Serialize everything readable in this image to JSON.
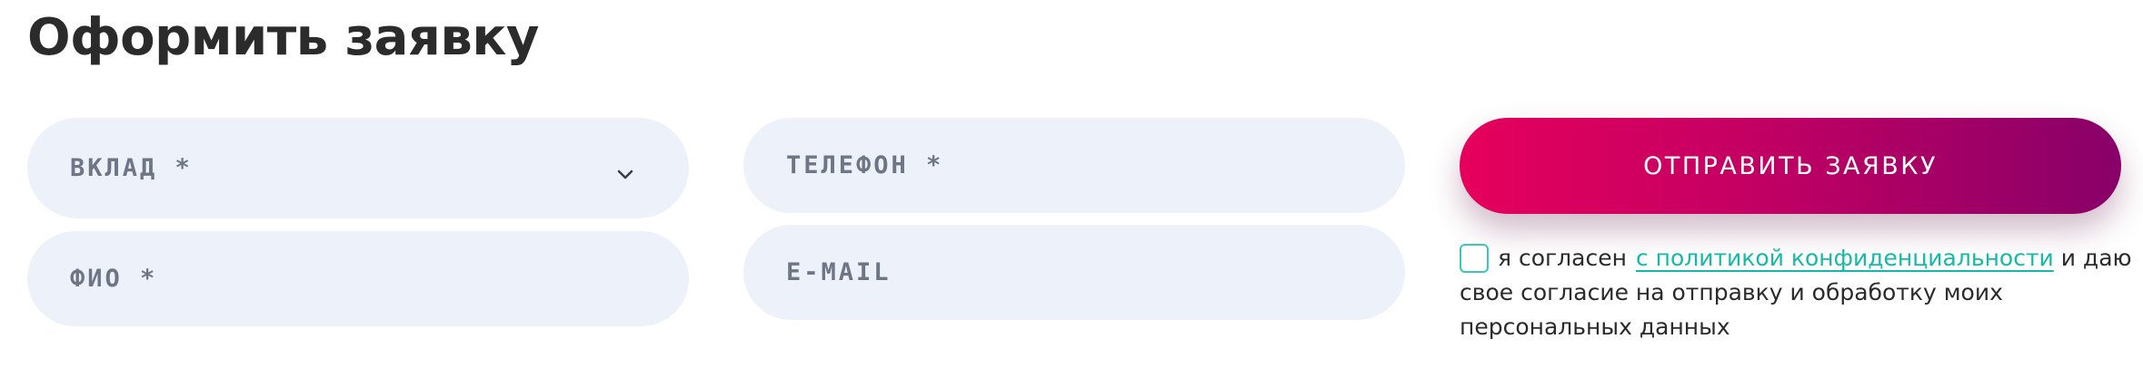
{
  "header": {
    "title": "Оформить заявку"
  },
  "form": {
    "deposit": {
      "label": "ВКЛАД *",
      "icon": "chevron-down-icon"
    },
    "fio": {
      "label": "ФИО *"
    },
    "phone": {
      "label": "ТЕЛЕФОН *"
    },
    "email": {
      "label": "E-MAIL"
    },
    "submit_label": "ОТПРАВИТЬ ЗАЯВКУ",
    "consent": {
      "checked": false,
      "text_before": "я согласен",
      "link_text": "с политикой конфиденциальности",
      "text_after": " и даю свое согласие на отправку и обработку моих персональных данных"
    }
  },
  "colors": {
    "accent_start": "#e6005c",
    "accent_end": "#870068",
    "link": "#17b9a6",
    "field_bg": "#edf2fa",
    "title": "#2b2b2b"
  }
}
